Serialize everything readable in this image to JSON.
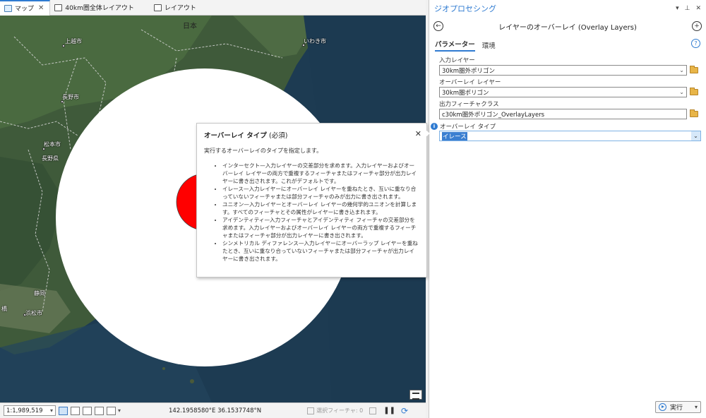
{
  "tabs": [
    {
      "label": "マップ",
      "active": true,
      "closable": true,
      "icon": "map-icon"
    },
    {
      "label": "40km圏全体レイアウト",
      "active": false,
      "icon": "layout-icon"
    },
    {
      "label": "レイアウト",
      "active": false,
      "icon": "layout-icon"
    }
  ],
  "map": {
    "country_label": "日本",
    "places": [
      "上越市",
      "いわき市",
      "長野市",
      "松本市",
      "長野県",
      "静岡",
      "浜松市",
      "橋"
    ],
    "colors": {
      "land": "#3f5a3a",
      "sea": "#1d3b52",
      "buffer": "#ffffff",
      "polygon": "#ff0000"
    }
  },
  "popup": {
    "title": "オーバーレイ タイプ",
    "title_suffix": "(必須)",
    "description": "実行するオーバーレイのタイプを指定します。",
    "items": [
      "インターセクト—入力レイヤーの交差部分を求めます。入力レイヤーおよびオーバーレイ レイヤーの両方で重複するフィーチャまたはフィーチャ部分が出力レイヤーに書き出されます。これがデフォルトです。",
      "イレース—入力レイヤーにオーバーレイ レイヤーを重ねたとき、互いに重なり合っていないフィーチャまたは部分フィーチャのみが出力に書き出されます。",
      "ユニオン—入力レイヤーとオーバーレイ レイヤーの幾何学的ユニオンを計算します。すべてのフィーチャとその属性がレイヤーに書き込まれます。",
      "アイデンティティ—入力フィーチャとアイデンティティ フィーチャの交差部分を求めます。入力レイヤーおよびオーバーレイ レイヤーの両方で重複するフィーチャまたはフィーチャ部分が出力レイヤーに書き出されます。",
      "シンメトリカル ディファレンス—入力レイヤーにオーバーラップ レイヤーを重ねたとき、互いに重なり合っていないフィーチャまたは部分フィーチャが出力レイヤーに書き出されます。"
    ]
  },
  "statusbar": {
    "scale": "1:1,989,519",
    "coordinates": "142.1958580°E 36.1537748°N",
    "selected_features": "選択フィーチャ: 0"
  },
  "gp": {
    "pane_title": "ジオプロセシング",
    "tool_title": "レイヤーのオーバーレイ (Overlay Layers)",
    "tabs": [
      "パラメーター",
      "環境"
    ],
    "params": {
      "input_label": "入力レイヤー",
      "input_value": "30km圏外ポリゴン",
      "overlay_label": "オーバーレイ レイヤー",
      "overlay_value": "30km圏ポリゴン",
      "output_label": "出力フィーチャクラス",
      "output_value": "c30km圏外ポリゴン_OverlayLayers",
      "type_label": "オーバーレイ タイプ",
      "type_value": "イレース"
    },
    "run_label": "実行"
  }
}
